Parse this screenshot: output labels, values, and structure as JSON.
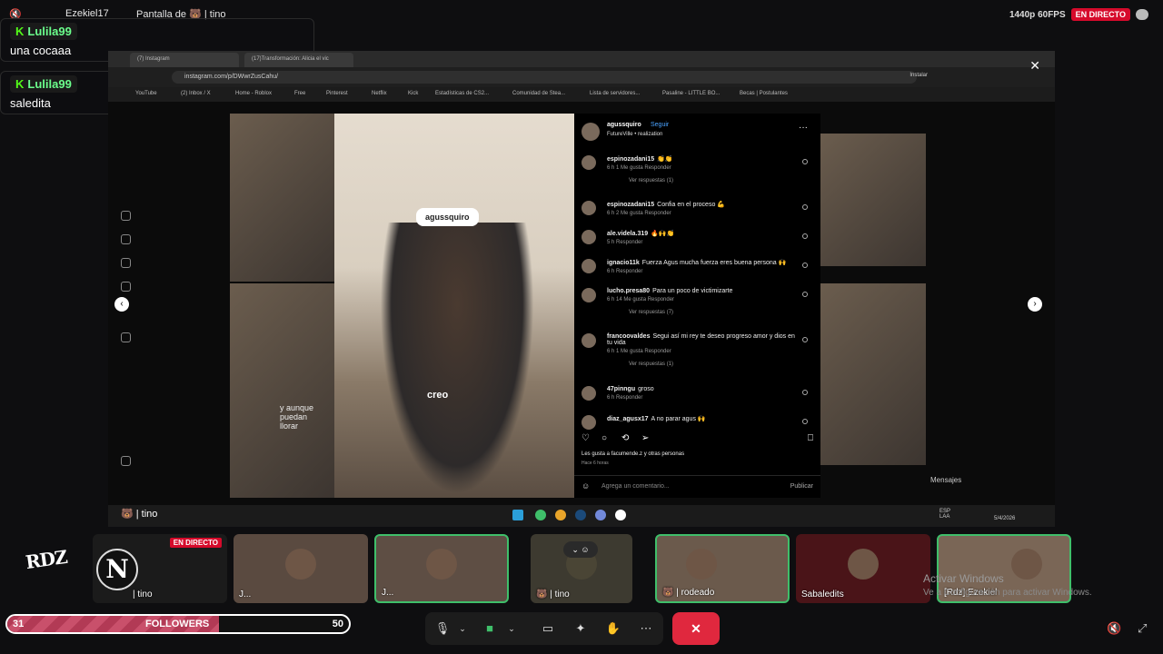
{
  "topbar": {
    "user1": "Ezekiel17",
    "share_label": "Pantalla de 🐻 | tino",
    "quality": "1440p 60FPS",
    "live": "EN DIRECTO"
  },
  "chat": [
    {
      "user": "Lulila99",
      "text": "una cocaaa"
    },
    {
      "user": "Lulila99",
      "text": "saledita"
    }
  ],
  "browser": {
    "tabs": [
      "(7) Instagram",
      "(17)Transformación: Alicia el vic"
    ],
    "url": "instagram.com/p/DWwrZusCahu/",
    "install": "Instalar",
    "bookmarks": [
      "YouTube",
      "(2) Inbox / X",
      "Home - Roblox",
      "Free",
      "Pinterest",
      "Netflix",
      "Kick",
      "Estadísticas de CS2...",
      "Comunidad de Stea...",
      "Lista de servidores...",
      "Pasaline - LITTLE BO...",
      "Becas | Postulantes"
    ]
  },
  "post": {
    "username": "agussquiro",
    "follow": "Seguir",
    "subtitle": "FutureVille • realization",
    "tag": "agussquiro",
    "shirt": "creo",
    "overlay_text": "y aunque\npuedan\nllorar",
    "comments": [
      {
        "user": "espinozadani15",
        "text": "👏👏",
        "meta": "6 h   1 Me gusta   Responder",
        "replies": "Ver respuestas (1)"
      },
      {
        "user": "espinozadani15",
        "text": "Confia en el proceso 💪",
        "meta": "6 h   2 Me gusta   Responder"
      },
      {
        "user": "ale.videla.319",
        "text": "🔥🙌👏",
        "meta": "5 h   Responder"
      },
      {
        "user": "ignacio11k",
        "text": "Fuerza Agus mucha fuerza eres buena persona 🙌",
        "meta": "6 h   Responder"
      },
      {
        "user": "lucho.presa80",
        "text": "Para un poco de victimizarte",
        "meta": "6 h   14 Me gusta   Responder",
        "replies": "Ver respuestas (7)"
      },
      {
        "user": "francoovaldes",
        "text": "Segui así mi rey te deseo progreso amor y dios en tu vida",
        "meta": "6 h   1 Me gusta   Responder",
        "replies": "Ver respuestas (1)"
      },
      {
        "user": "47pinngu",
        "text": "groso",
        "meta": "6 h   Responder"
      },
      {
        "user": "diaz_agusx17",
        "text": "A no parar agus 🙌",
        "meta": ""
      }
    ],
    "likes": "Les gusta a facumende.z y otras personas",
    "time": "Hace 6 horas",
    "comment_placeholder": "Agrega un comentario...",
    "publish": "Publicar"
  },
  "mensajes": "Mensajes",
  "share_name": "🐻 | tino",
  "taskbar": {
    "lang": "ESP\nLAA",
    "date": "5/4/2026"
  },
  "participants": [
    {
      "name": "| tino",
      "live": "EN DIRECTO"
    },
    {
      "name": "J..."
    },
    {
      "name": "J..."
    },
    {
      "name": "🐻 | tino"
    },
    {
      "name": "🐻 | rodeado"
    },
    {
      "name": "Sabaledits"
    },
    {
      "name": "[Rdz] Ezekiel"
    }
  ],
  "logos": {
    "rdz": "RDZ",
    "n": "N"
  },
  "followers": {
    "current": "31",
    "label": "FOLLOWERS",
    "goal": "50",
    "progress": 0.62
  },
  "windows": {
    "activate": "Activar Windows",
    "activate_sub": "Ve a Configuración para activar Windows."
  },
  "colors": {
    "live": "#d60a2b",
    "chat_user": "#6bff8c",
    "kick_green": "#53fc18",
    "end_call": "#e0283e",
    "active_border": "#3fbf6a"
  }
}
